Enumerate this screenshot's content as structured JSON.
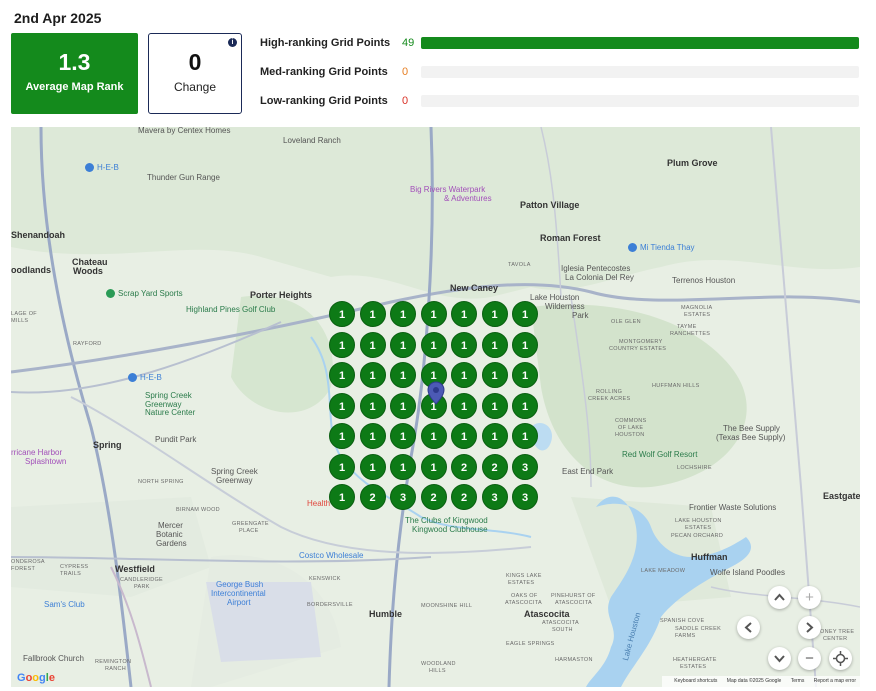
{
  "report": {
    "date": "2nd Apr 2025"
  },
  "stats": {
    "average_rank": {
      "value": "1.3",
      "label": "Average Map Rank"
    },
    "change": {
      "value": "0",
      "label": "Change",
      "info_icon": "info-icon"
    }
  },
  "ranking_bars": [
    {
      "label": "High-ranking Grid Points",
      "count": "49",
      "fraction": 1.0,
      "color": "#148a1c"
    },
    {
      "label": "Med-ranking Grid Points",
      "count": "0",
      "fraction": 0,
      "color": "#e67e22"
    },
    {
      "label": "Low-ranking Grid Points",
      "count": "0",
      "fraction": 0,
      "color": "#d93025"
    }
  ],
  "grid": {
    "rows": [
      [
        "1",
        "1",
        "1",
        "1",
        "1",
        "1",
        "1"
      ],
      [
        "1",
        "1",
        "1",
        "1",
        "1",
        "1",
        "1"
      ],
      [
        "1",
        "1",
        "1",
        "1",
        "1",
        "1",
        "1"
      ],
      [
        "1",
        "1",
        "1",
        "1",
        "1",
        "1",
        "1"
      ],
      [
        "1",
        "1",
        "1",
        "1",
        "1",
        "1",
        "1"
      ],
      [
        "1",
        "1",
        "1",
        "1",
        "2",
        "2",
        "3"
      ],
      [
        "1",
        "2",
        "3",
        "2",
        "2",
        "3",
        "3"
      ]
    ],
    "marker_icon": "location-pin-icon"
  },
  "map": {
    "labels": {
      "mavera": "Mavera by Centex Homes",
      "loveland": "Loveland Ranch",
      "heb1": "H-E-B",
      "thunder": "Thunder Gun Range",
      "bigrivers": "Big Rivers Waterpark",
      "bigrivers2": "& Adventures",
      "plumgrove": "Plum Grove",
      "patton": "Patton Village",
      "shenandoah": "Shenandoah",
      "romanforest": "Roman Forest",
      "tienda": "Mi Tienda Thay",
      "woodlands": "oodlands",
      "chateau": "Chateau",
      "chateau2": "Woods",
      "tavola": "TAVOLA",
      "iglesia": "Iglesia Pentecostes",
      "iglesia2": "La Colonia Del Rey",
      "terrenos": "Terrenos Houston",
      "newcaney": "New Caney",
      "scrapyard": "Scrap Yard Sports",
      "porter": "Porter Heights",
      "highland": "Highland Pines Golf Club",
      "lakehouston": "Lake Houston",
      "lakehouston2": "Wilderness",
      "lakehouston3": "Park",
      "magnolia": "MAGNOLIA",
      "magnolia2": "ESTATES",
      "ole": "OLE GLEN",
      "tayme": "TAYME",
      "tayme2": "RANCHETTES",
      "montgomery": "MONTGOMERY",
      "montgomery2": "COUNTRY ESTATES",
      "rayford": "RAYFORD",
      "lage": "LAGE OF",
      "lage2": "MILLS",
      "heb2": "H-E-B",
      "springcreek": "Spring Creek",
      "springcreek2": "Greenway",
      "springcreek3": "Nature Center",
      "huffmanhills": "HUFFMAN HILLS",
      "rolling": "ROLLING",
      "rolling2": "CREEK ACRES",
      "commons": "COMMONS",
      "commons2": "OF LAKE",
      "commons3": "HOUSTON",
      "beesupply": "The Bee Supply",
      "beesupply2": "(Texas Bee Supply)",
      "spring": "Spring",
      "pundit": "Pundit Park",
      "hurricane": "rricane Harbor",
      "hurricane2": "Splashtown",
      "redwolf": "Red Wolf Golf Resort",
      "locheshire": "LOCHSHIRE",
      "eastend": "East End Park",
      "springgreen": "Spring Creek",
      "springgreen2": "Greenway",
      "northspring": "NORTH SPRING",
      "eastgate": "Eastgate",
      "birnam": "BIRNAM WOOD",
      "frontier": "Frontier Waste Solutions",
      "mercer": "Mercer",
      "mercer2": "Botanic",
      "mercer3": "Gardens",
      "greengate": "GREENGATE",
      "greengate2": "PLACE",
      "kingwood": "The Clubs of Kingwood",
      "kingwood2": "Kingwood Clubhouse",
      "lakehoustonest": "LAKE HOUSTON",
      "lakehoustonest2": "ESTATES",
      "pecan": "PECAN ORCHARD",
      "costco": "Costco Wholesale",
      "huffman": "Huffman",
      "westfield": "Westfield",
      "cypress": "CYPRESS",
      "cypress2": "TRAILS",
      "candle": "CANDLERIDGE",
      "candle2": "PARK",
      "kenwick": "KENSWICK",
      "wolfe": "Wolfe Island Poodles",
      "lakemeadow": "LAKE MEADOW",
      "kingslake": "KINGS LAKE",
      "kingslake2": "ESTATES",
      "oaks": "OAKS OF",
      "oaks2": "ATASCOCITA",
      "pinehurst": "PINEHURST OF",
      "pinehurst2": "ATASCOCITA",
      "georgebush": "George Bush",
      "georgebush2": "Intercontinental",
      "georgebush3": "Airport",
      "samsclub": "Sam's Club",
      "humble": "Humble",
      "atascocita": "Atascocita",
      "moonshine": "MOONSHINE HILL",
      "bordersville": "BORDERSVILLE",
      "spanish": "SPANISH COVE",
      "saddle": "SADDLE CREEK",
      "saddle2": "FARMS",
      "atascocitasouth": "ATASCOCITA",
      "atascocitasouth2": "SOUTH",
      "eaglesprings": "EAGLE SPRINGS",
      "harmaston": "HARMASTON",
      "heathergate": "HEATHERGATE",
      "heathergate2": "ESTATES",
      "woodland": "WOODLAND",
      "woodland2": "HILLS",
      "fallbrook": "Fallbrook Church",
      "remington": "REMINGTON",
      "remington2": "RANCH",
      "lakehoustonlake": "Lake Houston",
      "health": "Health",
      "onderosa": "ONDEROSA",
      "onderosa2": "FOREST",
      "ontreecenter": "ONEY TREE",
      "ontreecenter2": "CENTER"
    },
    "google": "Google",
    "attribution": {
      "shortcuts": "Keyboard shortcuts",
      "mapdata": "Map data ©2025 Google",
      "terms": "Terms",
      "report": "Report a map error"
    },
    "controls": {
      "up": "chevron-up-icon",
      "down": "chevron-down-icon",
      "left": "chevron-left-icon",
      "right": "chevron-right-icon",
      "zoom_in": "+",
      "zoom_out": "−",
      "recenter": "recenter-icon"
    }
  }
}
